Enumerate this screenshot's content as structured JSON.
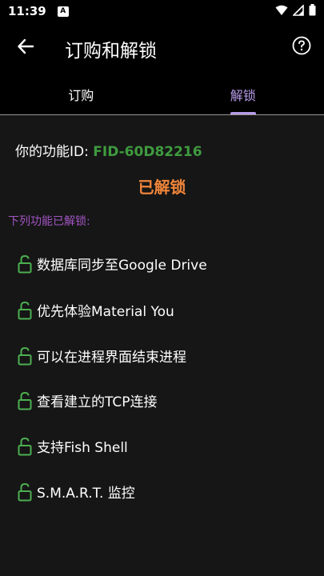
{
  "status_bar": {
    "time": "11:39",
    "notification_badge": "A",
    "icons": [
      "wifi-icon",
      "cellular-signal-icon",
      "battery-icon"
    ]
  },
  "app_bar": {
    "title": "订购和解锁",
    "back_icon": "arrow-back-icon",
    "help_icon": "help-circle-icon"
  },
  "tabs": [
    {
      "label": "订购",
      "active": false
    },
    {
      "label": "解锁",
      "active": true
    }
  ],
  "content": {
    "fid_label": "你的功能ID: ",
    "fid_value": "FID-60D82216",
    "status": "已解锁",
    "section_label": "下列功能已解锁:",
    "features": [
      {
        "label": "数据库同步至Google Drive",
        "icon": "lock-open-icon"
      },
      {
        "label": "优先体验Material You",
        "icon": "lock-open-icon"
      },
      {
        "label": "可以在进程界面结束进程",
        "icon": "lock-open-icon"
      },
      {
        "label": "查看建立的TCP连接",
        "icon": "lock-open-icon"
      },
      {
        "label": "支持Fish Shell",
        "icon": "lock-open-icon"
      },
      {
        "label": "S.M.A.R.T. 监控",
        "icon": "lock-open-icon"
      }
    ]
  },
  "colors": {
    "accent": "#b79ae8",
    "fid_green": "#3f9b3f",
    "status_orange": "#f0853a",
    "section_purple": "#a255c4",
    "lock_green": "#4caf50"
  }
}
